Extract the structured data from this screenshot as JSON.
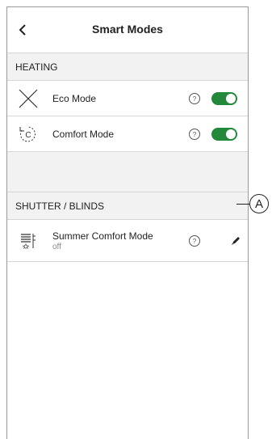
{
  "header": {
    "title": "Smart Modes"
  },
  "sections": [
    {
      "title": "HEATING",
      "items": [
        {
          "label": "Eco Mode",
          "icon": "eco-mode-icon",
          "toggle_on": true
        },
        {
          "label": "Comfort Mode",
          "icon": "comfort-mode-icon",
          "toggle_on": true,
          "icon_text": "C"
        }
      ]
    },
    {
      "title": "SHUTTER / BLINDS",
      "items": [
        {
          "label": "Summer Comfort Mode",
          "sublabel": "off",
          "icon": "blinds-icon"
        }
      ]
    }
  ],
  "annotation": {
    "label": "A"
  },
  "colors": {
    "toggle_on": "#23883a",
    "section_bg": "#f2f2f2",
    "divider": "#d6d6d6"
  }
}
